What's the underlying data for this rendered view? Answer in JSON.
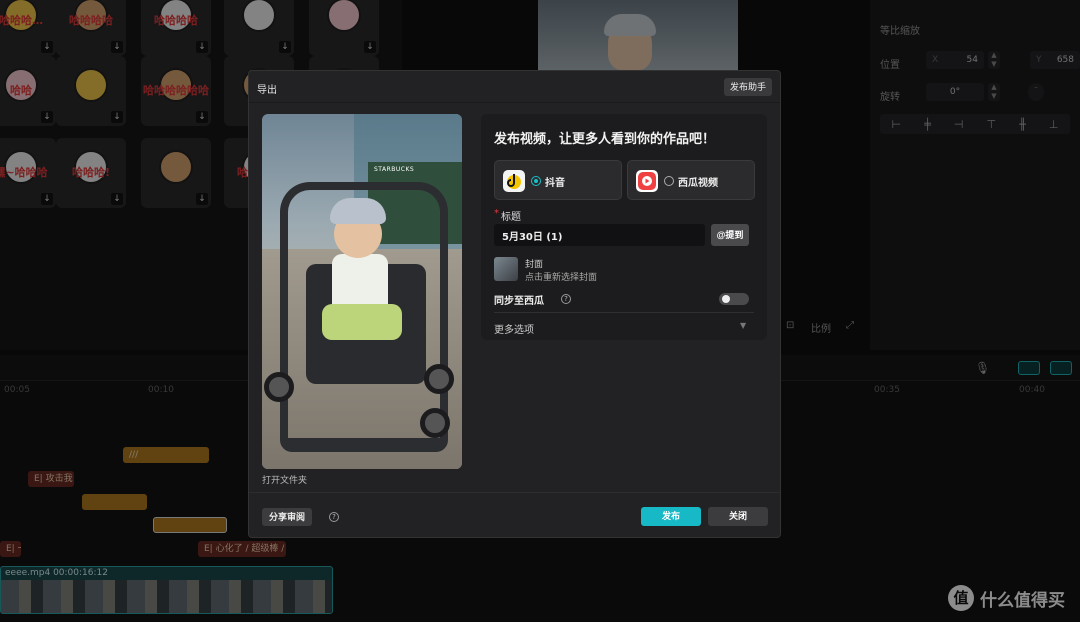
{
  "editor": {
    "stickers": [
      {
        "text": "哈哈哈…",
        "variant": "yellow"
      },
      {
        "text": "哈哈哈哈",
        "variant": "tan"
      },
      {
        "text": "哈哈哈哈",
        "variant": "plain"
      },
      {
        "text": "",
        "variant": "plain"
      },
      {
        "text": "",
        "variant": "pink"
      },
      {
        "text": "哈哈",
        "variant": "pink"
      },
      {
        "text": "",
        "variant": "yellow"
      },
      {
        "text": "哈哈哈哈哈哈",
        "variant": "tan"
      },
      {
        "text": "哈哈",
        "variant": "tan"
      },
      {
        "text": "",
        "variant": "plain"
      },
      {
        "text": "嘿~哈哈哈",
        "variant": "plain"
      },
      {
        "text": "哈哈哈!",
        "variant": "plain"
      },
      {
        "text": "",
        "variant": "tan"
      },
      {
        "text": "哈哈哈哈",
        "variant": "plain"
      },
      {
        "text": "",
        "variant": "plain"
      }
    ],
    "properties": {
      "scale_label": "等比缩放",
      "position_label": "位置",
      "x_prefix": "X",
      "x_value": "54",
      "y_prefix": "Y",
      "y_value": "658",
      "rotation_label": "旋转",
      "rotation_value": "0°"
    },
    "preview_ratio_label": "比例",
    "timeline": {
      "ticks": [
        "00:05",
        "00:10",
        "00:35",
        "00:40"
      ],
      "clips": [
        {
          "label": "///",
          "color": "orange"
        },
        {
          "label": "E| 攻击我",
          "color": "red"
        },
        {
          "label": "",
          "color": "orange"
        },
        {
          "label": "",
          "color": "orange"
        },
        {
          "label": "E| 一扭",
          "color": "red"
        },
        {
          "label": "E| 心化了 / 超级棒 /",
          "color": "red"
        }
      ],
      "video_track_label": "eeee.mp4  00:00:16:12"
    }
  },
  "watermark": {
    "icon": "值",
    "text": "什么值得买"
  },
  "export_dialog": {
    "title": "导出",
    "assistant_button": "发布助手",
    "open_folder": "打开文件夹",
    "heading": "发布视频，让更多人看到你的作品吧！",
    "platforms": [
      {
        "label": "抖音",
        "selected": true,
        "icon": "douyin-logo"
      },
      {
        "label": "西瓜视频",
        "selected": false,
        "icon": "xigua-logo"
      }
    ],
    "title_field": {
      "label": "标题",
      "value": "5月30日 (1)",
      "mention_button": "@提到"
    },
    "cover": {
      "label": "封面",
      "hint": "点击重新选择封面"
    },
    "sync": {
      "label": "同步至西瓜",
      "enabled": false
    },
    "more_options": "更多选项",
    "share_review_button": "分享审阅",
    "publish_button": "发布",
    "close_button": "关闭"
  },
  "colors": {
    "accent": "#17b9c6",
    "required": "#e2373f",
    "video_track": "#2aa3a6"
  }
}
